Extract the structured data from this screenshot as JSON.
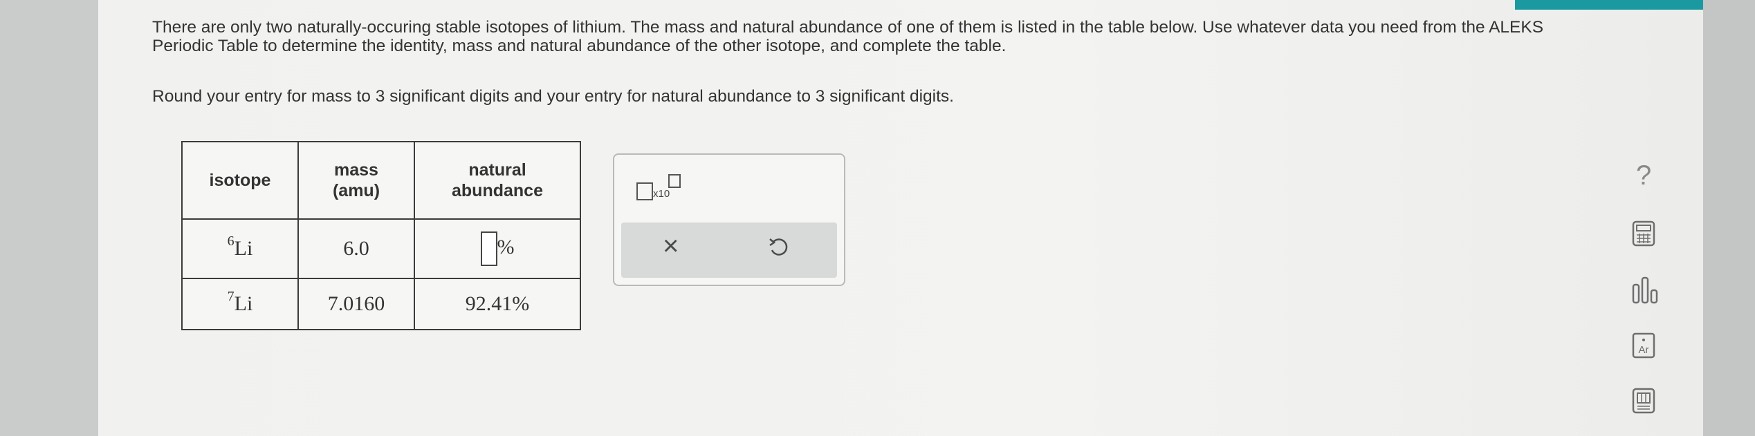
{
  "question": {
    "paragraph1": "There are only two naturally-occuring stable isotopes of lithium. The mass and natural abundance of one of them is listed in the table below. Use whatever data you need from the ALEKS Periodic Table to determine the identity, mass and natural abundance of the other isotope, and complete the table.",
    "paragraph2": "Round your entry for mass to 3 significant digits and your entry for natural abundance to 3 significant digits."
  },
  "table": {
    "headers": {
      "isotope": "isotope",
      "mass_line1": "mass",
      "mass_line2": "(amu)",
      "abundance_line1": "natural",
      "abundance_line2": "abundance"
    },
    "rows": [
      {
        "mass_number": "6",
        "symbol": "Li",
        "mass": "6.0",
        "abundance_unit": "%"
      },
      {
        "mass_number": "7",
        "symbol": "Li",
        "mass": "7.0160",
        "abundance": "92.41%"
      }
    ]
  },
  "tools": {
    "x10_label": "x10",
    "clear_symbol": "×"
  },
  "sidebar": {
    "help_symbol": "?",
    "periodic_label": "Ar"
  },
  "colors": {
    "accent": "#1a9aa0",
    "background": "#f1f1ef"
  }
}
